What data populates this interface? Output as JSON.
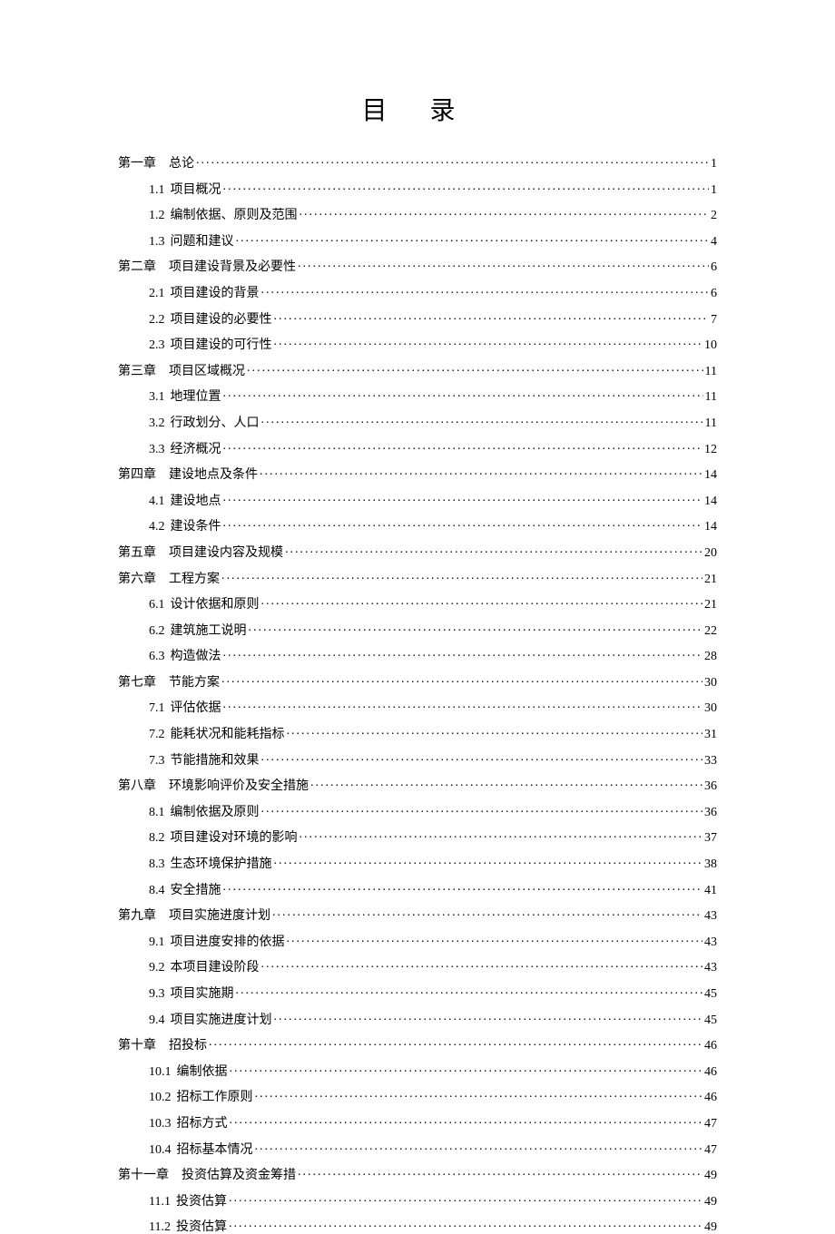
{
  "title": "目 录",
  "toc": [
    {
      "level": 1,
      "num": "第一章",
      "label": "总论",
      "page": "1"
    },
    {
      "level": 2,
      "num": "1.1",
      "label": "项目概况",
      "page": "1"
    },
    {
      "level": 2,
      "num": "1.2",
      "label": "编制依据、原则及范围",
      "page": "2"
    },
    {
      "level": 2,
      "num": "1.3",
      "label": "问题和建议",
      "page": "4"
    },
    {
      "level": 1,
      "num": "第二章",
      "label": "项目建设背景及必要性",
      "page": "6"
    },
    {
      "level": 2,
      "num": "2.1",
      "label": "项目建设的背景",
      "page": "6"
    },
    {
      "level": 2,
      "num": "2.2",
      "label": "项目建设的必要性",
      "page": "7"
    },
    {
      "level": 2,
      "num": "2.3",
      "label": "项目建设的可行性",
      "page": "10"
    },
    {
      "level": 1,
      "num": "第三章",
      "label": "项目区域概况",
      "page": "11"
    },
    {
      "level": 2,
      "num": "3.1",
      "label": "地理位置",
      "page": "11"
    },
    {
      "level": 2,
      "num": "3.2",
      "label": "行政划分、人口",
      "page": "11"
    },
    {
      "level": 2,
      "num": "3.3",
      "label": "经济概况",
      "page": "12"
    },
    {
      "level": 1,
      "num": "第四章",
      "label": "建设地点及条件",
      "page": "14"
    },
    {
      "level": 2,
      "num": "4.1",
      "label": "建设地点",
      "page": "14"
    },
    {
      "level": 2,
      "num": "4.2",
      "label": "建设条件",
      "page": "14"
    },
    {
      "level": 1,
      "num": "第五章",
      "label": "项目建设内容及规模",
      "page": "20"
    },
    {
      "level": 1,
      "num": "第六章",
      "label": "工程方案",
      "page": "21"
    },
    {
      "level": 2,
      "num": "6.1",
      "label": "设计依据和原则",
      "page": "21"
    },
    {
      "level": 2,
      "num": "6.2",
      "label": "建筑施工说明",
      "page": "22"
    },
    {
      "level": 2,
      "num": "6.3",
      "label": "构造做法",
      "page": "28"
    },
    {
      "level": 1,
      "num": "第七章",
      "label": "节能方案",
      "page": "30"
    },
    {
      "level": 2,
      "num": "7.1",
      "label": "评估依据",
      "page": "30"
    },
    {
      "level": 2,
      "num": "7.2",
      "label": "能耗状况和能耗指标",
      "page": "31"
    },
    {
      "level": 2,
      "num": "7.3",
      "label": "节能措施和效果",
      "page": "33"
    },
    {
      "level": 1,
      "num": "第八章",
      "label": "环境影响评价及安全措施",
      "page": "36"
    },
    {
      "level": 2,
      "num": "8.1",
      "label": "编制依据及原则",
      "page": "36"
    },
    {
      "level": 2,
      "num": "8.2",
      "label": "项目建设对环境的影响",
      "page": "37"
    },
    {
      "level": 2,
      "num": "8.3",
      "label": "生态环境保护措施",
      "page": "38"
    },
    {
      "level": 2,
      "num": "8.4",
      "label": "安全措施",
      "page": "41"
    },
    {
      "level": 1,
      "num": "第九章",
      "label": "项目实施进度计划",
      "page": "43"
    },
    {
      "level": 2,
      "num": "9.1",
      "label": "项目进度安排的依据",
      "page": "43"
    },
    {
      "level": 2,
      "num": "9.2",
      "label": "本项目建设阶段",
      "page": "43"
    },
    {
      "level": 2,
      "num": "9.3",
      "label": "项目实施期",
      "page": "45"
    },
    {
      "level": 2,
      "num": "9.4",
      "label": "项目实施进度计划",
      "page": "45"
    },
    {
      "level": 1,
      "num": "第十章",
      "label": "招投标",
      "page": "46"
    },
    {
      "level": 2,
      "num": "10.1",
      "label": "编制依据",
      "page": "46"
    },
    {
      "level": 2,
      "num": "10.2",
      "label": "招标工作原则",
      "page": "46"
    },
    {
      "level": 2,
      "num": "10.3",
      "label": "招标方式",
      "page": "47"
    },
    {
      "level": 2,
      "num": "10.4",
      "label": "招标基本情况",
      "page": "47"
    },
    {
      "level": 1,
      "num": "第十一章",
      "label": "投资估算及资金筹措",
      "page": "49"
    },
    {
      "level": 2,
      "num": "11.1",
      "label": "投资估算",
      "page": "49"
    },
    {
      "level": 2,
      "num": "11.2",
      "label": "投资估算",
      "page": "49"
    }
  ]
}
